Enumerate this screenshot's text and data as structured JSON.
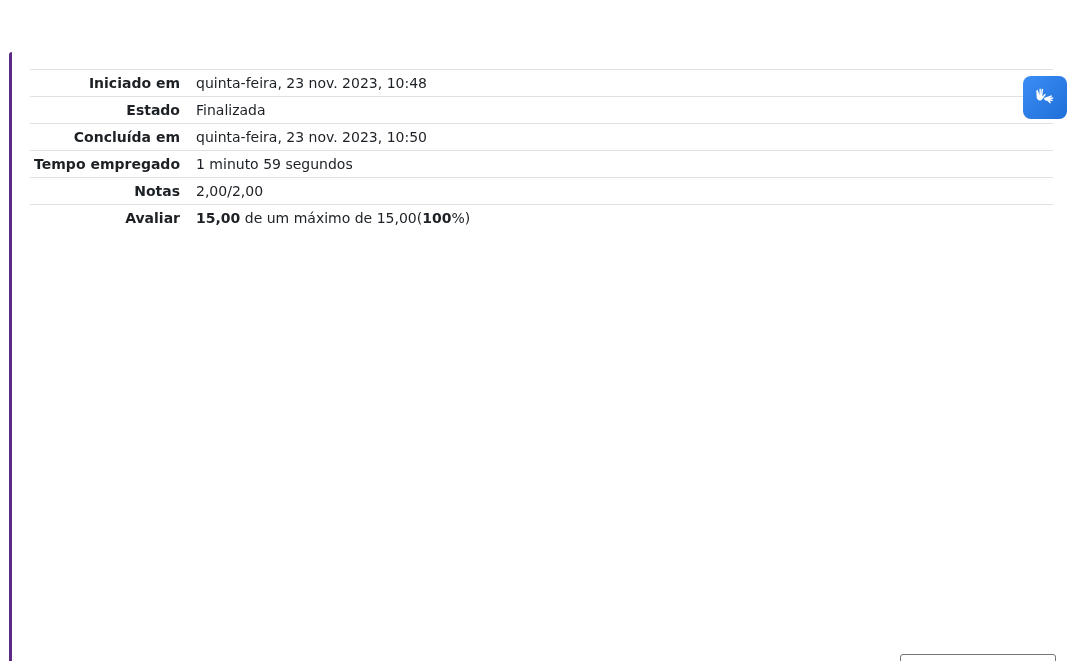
{
  "summary": {
    "rows": [
      {
        "label": "Iniciado em",
        "value": "quinta-feira, 23 nov. 2023, 10:48"
      },
      {
        "label": "Estado",
        "value": "Finalizada"
      },
      {
        "label": "Concluída em",
        "value": "quinta-feira, 23 nov. 2023, 10:50"
      },
      {
        "label": "Tempo empregado",
        "value": "1 minuto 59 segundos"
      },
      {
        "label": "Notas",
        "value": "2,00/2,00"
      },
      {
        "label": "Avaliar",
        "value": "**15,00** de um máximo de 15,00(**100**%)"
      }
    ]
  }
}
